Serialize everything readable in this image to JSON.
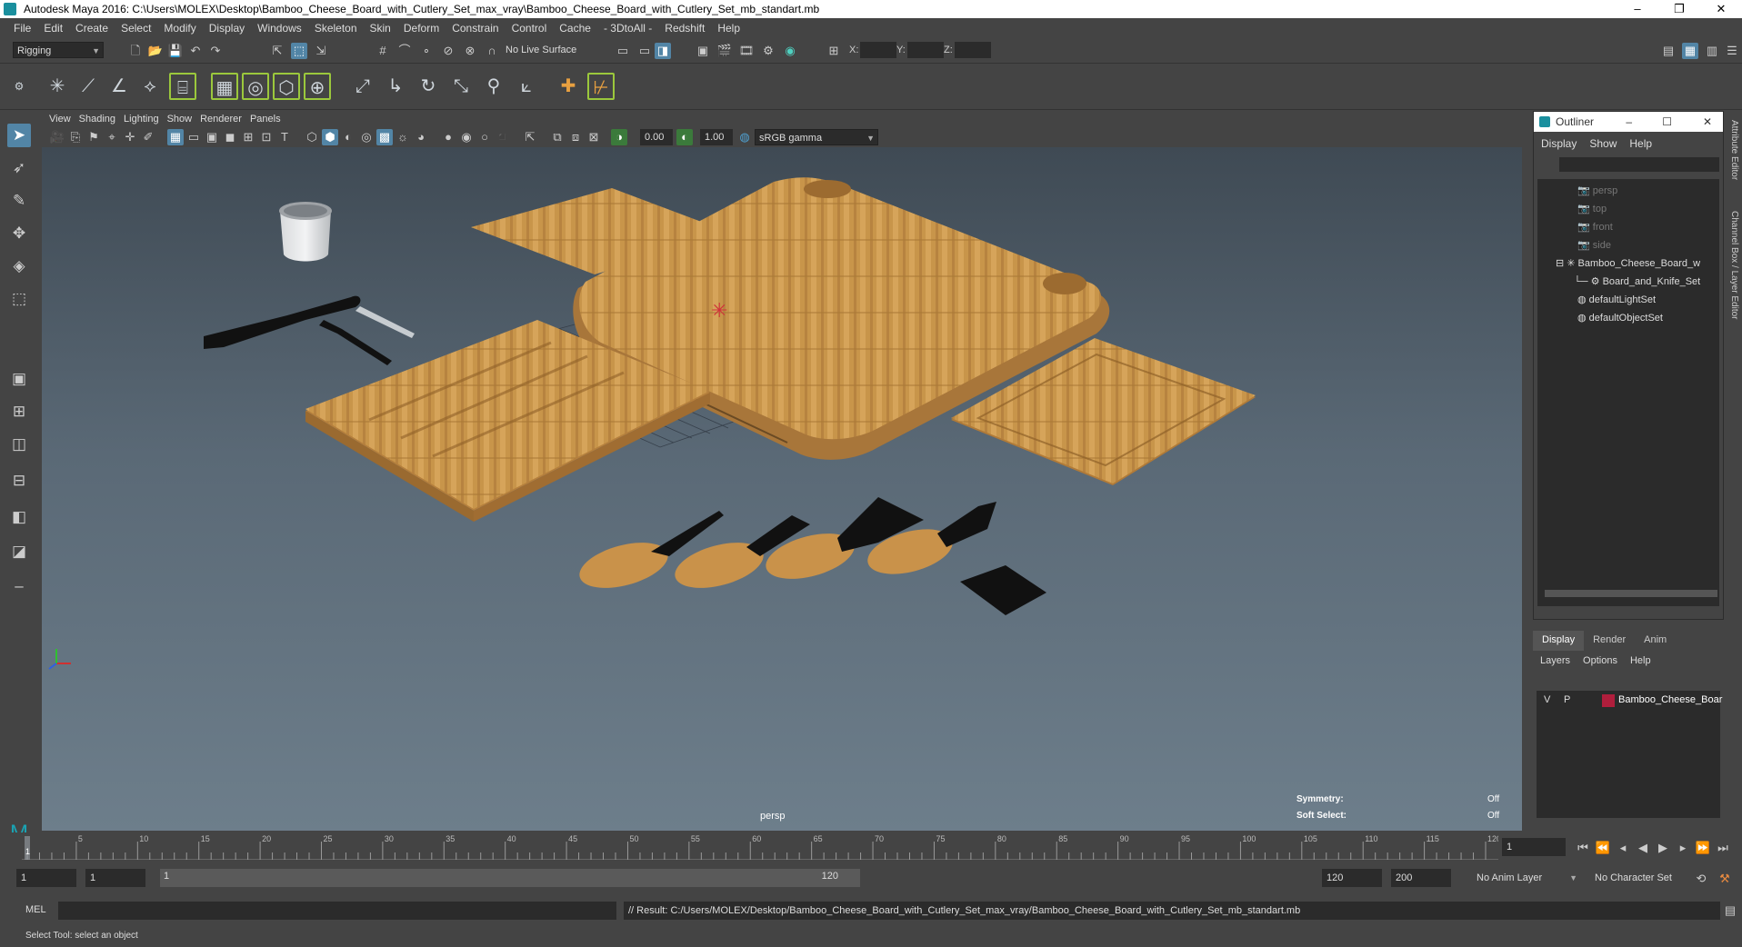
{
  "window": {
    "title": "Autodesk Maya 2016: C:\\Users\\MOLEX\\Desktop\\Bamboo_Cheese_Board_with_Cutlery_Set_max_vray\\Bamboo_Cheese_Board_with_Cutlery_Set_mb_standart.mb",
    "minimize": "–",
    "maximize": "❐",
    "close": "✕"
  },
  "menubar": [
    "File",
    "Edit",
    "Create",
    "Select",
    "Modify",
    "Display",
    "Windows",
    "Skeleton",
    "Skin",
    "Deform",
    "Constrain",
    "Control",
    "Cache",
    "- 3DtoAll -",
    "Redshift",
    "Help"
  ],
  "statusline": {
    "menuset": "Rigging",
    "live_surface": "No Live Surface",
    "x_label": "X:",
    "y_label": "Y:",
    "z_label": "Z:"
  },
  "panel": {
    "menu": [
      "View",
      "Shading",
      "Lighting",
      "Show",
      "Renderer",
      "Panels"
    ],
    "exposure": "0.00",
    "gamma": "1.00",
    "colorspace": "sRGB gamma"
  },
  "viewport": {
    "camera": "persp",
    "symmetry_label": "Symmetry:",
    "symmetry_value": "Off",
    "soft_select_label": "Soft Select:",
    "soft_select_value": "Off"
  },
  "timeline": {
    "ticks": [
      "5",
      "10",
      "15",
      "20",
      "25",
      "30",
      "35",
      "40",
      "45",
      "50",
      "55",
      "60",
      "65",
      "70",
      "75",
      "80",
      "85",
      "90",
      "95",
      "100",
      "105",
      "110",
      "115",
      "120"
    ],
    "start_marker": "1",
    "current_frame": "1"
  },
  "range": {
    "start": "1",
    "playback_start": "1",
    "slider_start": "1",
    "slider_end": "120",
    "playback_end": "120",
    "end": "200",
    "anim_layer": "No Anim Layer",
    "character_set": "No Character Set"
  },
  "cmdline": {
    "label": "MEL",
    "result": "// Result: C:/Users/MOLEX/Desktop/Bamboo_Cheese_Board_with_Cutlery_Set_max_vray/Bamboo_Cheese_Board_with_Cutlery_Set_mb_standart.mb"
  },
  "helpline": "Select Tool: select an object",
  "outliner": {
    "title": "Outliner",
    "menu": [
      "Display",
      "Show",
      "Help"
    ],
    "items": [
      "persp",
      "top",
      "front",
      "side",
      "Bamboo_Cheese_Board_w",
      "Board_and_Knife_Set",
      "defaultLightSet",
      "defaultObjectSet"
    ]
  },
  "layers": {
    "tabs": [
      "Display",
      "Render",
      "Anim"
    ],
    "menu": [
      "Layers",
      "Options",
      "Help"
    ],
    "layer_v": "V",
    "layer_p": "P",
    "layer_name": "Bamboo_Cheese_Boar",
    "layer_color": "#b01e3c"
  },
  "side_tabs": [
    "Attribute Editor",
    "Channel Box / Layer Editor"
  ],
  "colors": {
    "accent": "#5285a6",
    "shelf_highlight": "#9bc83c",
    "bamboo": "#c8954a"
  }
}
